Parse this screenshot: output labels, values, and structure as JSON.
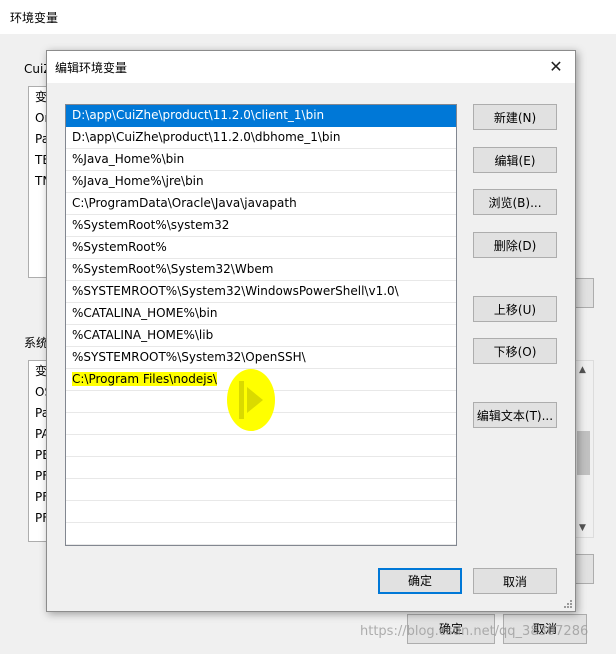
{
  "parent_window": {
    "title": "环境变量",
    "user_group_label": "CuiZ",
    "user_list": [
      "变",
      "Or",
      "Pa",
      "TE",
      "TN"
    ],
    "system_group_label": "系统",
    "system_list": [
      "变",
      "OS",
      "Pa",
      "PA",
      "PE",
      "PF",
      "PF",
      "PF"
    ],
    "ok_label": "确定",
    "cancel_label": "取消"
  },
  "dialog": {
    "title": "编辑环境变量",
    "paths": [
      "D:\\app\\CuiZhe\\product\\11.2.0\\client_1\\bin",
      "D:\\app\\CuiZhe\\product\\11.2.0\\dbhome_1\\bin",
      "%Java_Home%\\bin",
      "%Java_Home%\\jre\\bin",
      "C:\\ProgramData\\Oracle\\Java\\javapath",
      "%SystemRoot%\\system32",
      "%SystemRoot%",
      "%SystemRoot%\\System32\\Wbem",
      "%SYSTEMROOT%\\System32\\WindowsPowerShell\\v1.0\\",
      "%CATALINA_HOME%\\bin",
      "%CATALINA_HOME%\\lib",
      "%SYSTEMROOT%\\System32\\OpenSSH\\",
      "C:\\Program Files\\nodejs\\"
    ],
    "selected_index": 0,
    "highlighted_index": 12,
    "buttons": {
      "new": "新建(N)",
      "edit": "编辑(E)",
      "browse": "浏览(B)...",
      "delete": "删除(D)",
      "move_up": "上移(U)",
      "move_down": "下移(O)",
      "edit_text": "编辑文本(T)...",
      "ok": "确定",
      "cancel": "取消"
    },
    "close_icon": "close-icon"
  },
  "watermark": "https://blog.csdn.net/qq_38307286",
  "colors": {
    "selection": "#0078d7",
    "highlight": "#ffff00",
    "default_button_border": "#0078d7"
  }
}
